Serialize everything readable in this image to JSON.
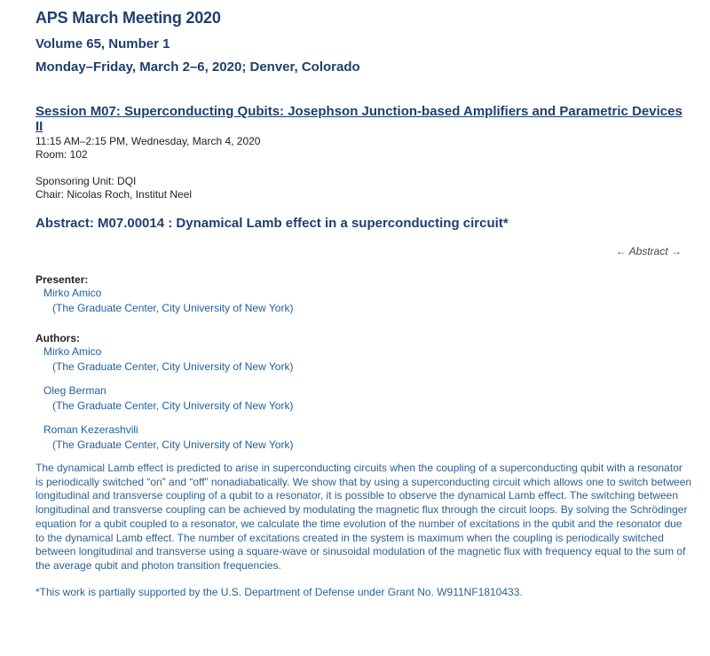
{
  "meeting": {
    "title": "APS March Meeting 2020",
    "volume": "Volume 65, Number 1",
    "dates": "Monday–Friday, March 2–6, 2020; Denver, Colorado"
  },
  "session": {
    "title": "Session M07: Superconducting Qubits: Josephson Junction-based Amplifiers and Parametric Devices II",
    "time": "11:15 AM–2:15 PM, Wednesday, March 4, 2020",
    "room": "Room: 102",
    "sponsor": "Sponsoring Unit: DQI",
    "chair": "Chair: Nicolas Roch, Institut Neel"
  },
  "abstract": {
    "heading": "Abstract: M07.00014 : Dynamical Lamb effect in a superconducting circuit*",
    "nav_label": "Abstract",
    "nav_prev_icon": "←",
    "nav_next_icon": "→",
    "text": "The dynamical Lamb effect is predicted to arise in superconducting circuits when the coupling of a superconducting qubit with a resonator is periodically switched “on” and “off” nonadiabatically. We show that by using a superconducting circuit which allows one to switch between longitudinal and transverse coupling of a qubit to a resonator, it is possible to observe the dynamical Lamb effect. The switching between longitudinal and transverse coupling can be achieved by modulating the magnetic flux through the circuit loops. By solving the Schrödinger equation for a qubit coupled to a resonator, we calculate the time evolution of the number of excitations in the qubit and the resonator due to the dynamical Lamb effect. The number of excitations created in the system is maximum when the coupling is periodically switched between longitudinal and transverse using a square-wave or sinusoidal modulation of the magnetic flux with frequency equal to the sum of the average qubit and photon transition frequencies.",
    "footnote": "*This work is partially supported by the U.S. Department of Defense under Grant No. W911NF1810433."
  },
  "presenter": {
    "label": "Presenter:",
    "name": "Mirko Amico",
    "affiliation": "(The Graduate Center, City University of New York)"
  },
  "authors": {
    "label": "Authors:",
    "list": [
      {
        "name": "Mirko Amico",
        "affiliation": "(The Graduate Center, City University of New York)"
      },
      {
        "name": "Oleg Berman",
        "affiliation": "(The Graduate Center, City University of New York)"
      },
      {
        "name": "Roman Kezerashvili",
        "affiliation": "(The Graduate Center, City University of New York)"
      }
    ]
  },
  "colors": {
    "heading": "#1f3f6e",
    "link": "#2060a0",
    "body_text": "#2e5f91"
  }
}
